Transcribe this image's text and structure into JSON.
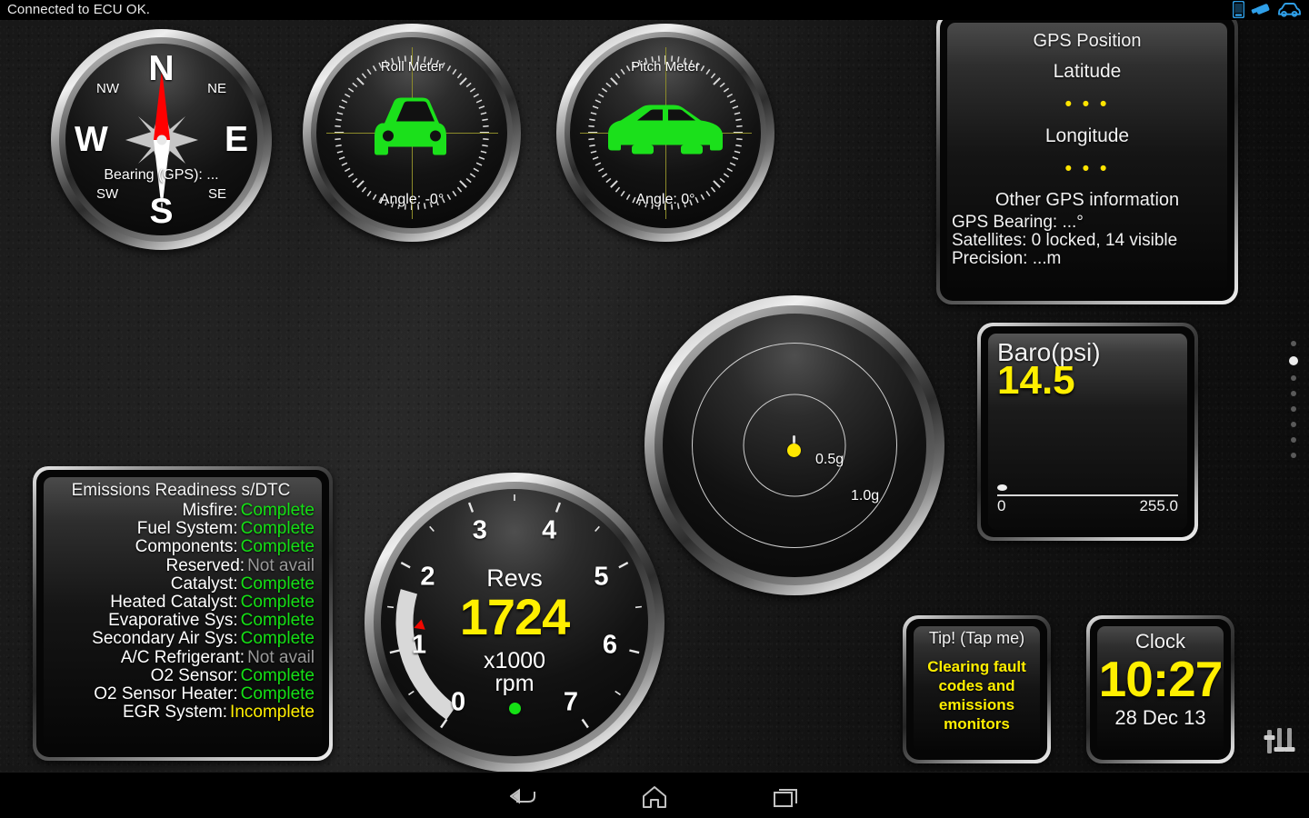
{
  "statusbar": {
    "text": "Connected to ECU OK.",
    "icons": [
      "phone-icon",
      "usb-drive-icon",
      "car-icon"
    ]
  },
  "compass": {
    "name": "compass-gauge",
    "cardinals": [
      "N",
      "E",
      "S",
      "W"
    ],
    "ordinals": [
      "NW",
      "NE",
      "SE",
      "SW"
    ],
    "bearing_label": "Bearing (GPS): ...",
    "needle_color": "#ff0000"
  },
  "roll_meter": {
    "title": "Roll Meter",
    "angle": "Angle: -0°",
    "car_color": "#1be01b",
    "crosshair_color": "#8c8a2a"
  },
  "pitch_meter": {
    "title": "Pitch Meter",
    "angle": "Angle: 0°",
    "car_color": "#1be01b",
    "crosshair_color": "#8c8a2a"
  },
  "gps_panel": {
    "title": "GPS Position",
    "latitude_label": "Latitude",
    "latitude_value": "• • •",
    "longitude_label": "Longitude",
    "longitude_value": "• • •",
    "other_title": "Other GPS information",
    "bearing": "GPS Bearing: ...°",
    "satellites": "Satellites: 0 locked, 14 visible",
    "precision": "Precision: ...m",
    "dot_color": "#ffe400"
  },
  "baro": {
    "label": "Baro(psi)",
    "value": "14.5",
    "range_min": "0",
    "range_max": "255.0",
    "value_color": "#ffef00",
    "knob_fraction": 0.0
  },
  "gmeter": {
    "name": "g-force-meter",
    "ring_labels": [
      "0.5g",
      "1.0g"
    ],
    "dot_color": "#ffe800"
  },
  "tachometer": {
    "caption": "Revs",
    "value": "1724",
    "unit_line1": "x1000",
    "unit_line2": "rpm",
    "ticks": [
      "0",
      "1",
      "2",
      "3",
      "4",
      "5",
      "6",
      "7"
    ],
    "value_color": "#ffef00",
    "arc_color": "#d8d8d8",
    "marker_color": "#f00800",
    "indicator_color": "#15e015"
  },
  "emissions": {
    "title": "Emissions Readiness s/DTC",
    "rows": [
      {
        "label": "Misfire:",
        "value": "Complete",
        "state": "ok"
      },
      {
        "label": "Fuel System:",
        "value": "Complete",
        "state": "ok"
      },
      {
        "label": "Components:",
        "value": "Complete",
        "state": "ok"
      },
      {
        "label": "Reserved:",
        "value": "Not avail",
        "state": "na"
      },
      {
        "label": "Catalyst:",
        "value": "Complete",
        "state": "ok"
      },
      {
        "label": "Heated Catalyst:",
        "value": "Complete",
        "state": "ok"
      },
      {
        "label": "Evaporative Sys:",
        "value": "Complete",
        "state": "ok"
      },
      {
        "label": "Secondary Air Sys:",
        "value": "Complete",
        "state": "ok"
      },
      {
        "label": "A/C Refrigerant:",
        "value": "Not avail",
        "state": "na"
      },
      {
        "label": "O2 Sensor:",
        "value": "Complete",
        "state": "ok"
      },
      {
        "label": "O2 Sensor Heater:",
        "value": "Complete",
        "state": "ok"
      },
      {
        "label": "EGR System:",
        "value": "Incomplete",
        "state": "inc"
      }
    ],
    "colors": {
      "ok": "#15e015",
      "na": "#9a9a9a",
      "inc": "#ffef00"
    }
  },
  "tip": {
    "title": "Tip! (Tap me)",
    "text": "Clearing fault codes and emissions monitors",
    "text_color": "#ffef00"
  },
  "clock": {
    "title": "Clock",
    "time": "10:27",
    "date": "28 Dec 13",
    "time_color": "#ffef00"
  },
  "pager": {
    "total": 8,
    "active_index": 1
  },
  "navbar": {
    "buttons": [
      "back-button",
      "home-button",
      "recents-button"
    ]
  },
  "settings_icon": "sliders-icon"
}
